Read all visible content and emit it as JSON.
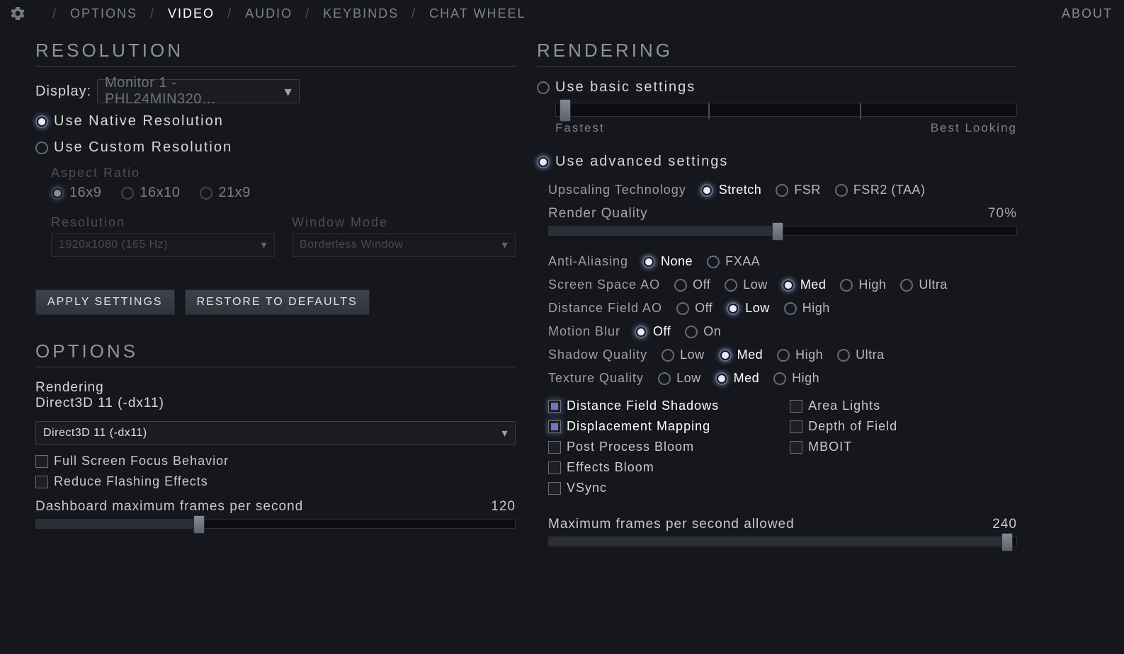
{
  "nav": {
    "items": [
      "OPTIONS",
      "VIDEO",
      "AUDIO",
      "KEYBINDS",
      "CHAT WHEEL"
    ],
    "active": "VIDEO",
    "about": "ABOUT"
  },
  "resolution": {
    "title": "RESOLUTION",
    "displayLabel": "Display:",
    "displayValue": "Monitor 1 - PHL24MIN320…",
    "nativeLabel": "Use Native Resolution",
    "customLabel": "Use Custom Resolution",
    "aspectLabel": "Aspect Ratio",
    "aspects": [
      "16x9",
      "16x10",
      "21x9"
    ],
    "resolutionLabel": "Resolution",
    "resolutionValue": "1920x1080 (165 Hz)",
    "windowModeLabel": "Window Mode",
    "windowModeValue": "Borderless Window",
    "applyBtn": "APPLY SETTINGS",
    "restoreBtn": "RESTORE TO DEFAULTS"
  },
  "options": {
    "title": "OPTIONS",
    "renderingLabel": "Rendering",
    "renderingCurrent": "Direct3D 11 (-dx11)",
    "renderingSelectValue": "Direct3D 11 (-dx11)",
    "fullscreenFocus": "Full Screen Focus Behavior",
    "reduceFlashing": "Reduce Flashing Effects",
    "dashFpsLabel": "Dashboard maximum frames per second",
    "dashFpsValue": "120"
  },
  "rendering": {
    "title": "RENDERING",
    "basicLabel": "Use basic settings",
    "sliderLeft": "Fastest",
    "sliderRight": "Best Looking",
    "advancedLabel": "Use advanced settings",
    "upscalingLabel": "Upscaling Technology",
    "upscalingOptions": [
      "Stretch",
      "FSR",
      "FSR2 (TAA)"
    ],
    "renderQualityLabel": "Render Quality",
    "renderQualityValue": "70%",
    "aaLabel": "Anti-Aliasing",
    "aaOptions": [
      "None",
      "FXAA"
    ],
    "ssaoLabel": "Screen Space AO",
    "ssaoOptions": [
      "Off",
      "Low",
      "Med",
      "High",
      "Ultra"
    ],
    "dfaoLabel": "Distance Field AO",
    "dfaoOptions": [
      "Off",
      "Low",
      "High"
    ],
    "motionBlurLabel": "Motion Blur",
    "motionBlurOptions": [
      "Off",
      "On"
    ],
    "shadowLabel": "Shadow Quality",
    "shadowOptions": [
      "Low",
      "Med",
      "High",
      "Ultra"
    ],
    "textureLabel": "Texture Quality",
    "textureOptions": [
      "Low",
      "Med",
      "High"
    ],
    "checksLeft": [
      "Distance Field Shadows",
      "Displacement Mapping",
      "Post Process Bloom",
      "Effects Bloom",
      "VSync"
    ],
    "checksRight": [
      "Area Lights",
      "Depth of Field",
      "MBOIT"
    ],
    "maxFpsLabel": "Maximum frames per second allowed",
    "maxFpsValue": "240"
  }
}
